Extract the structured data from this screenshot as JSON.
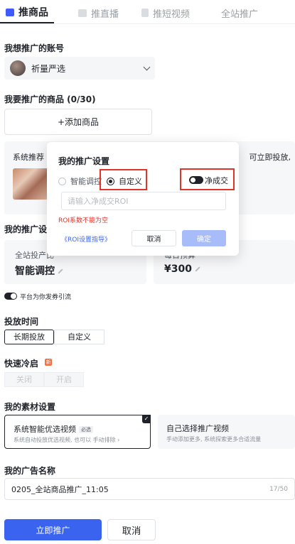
{
  "tabs": [
    {
      "label": "推商品",
      "icon": "shop-bag-icon",
      "active": true
    },
    {
      "label": "推直播",
      "icon": "live-camera-icon",
      "active": false
    },
    {
      "label": "推短视频",
      "icon": "video-file-icon",
      "active": false
    },
    {
      "label": "全站推广",
      "active": false
    }
  ],
  "account": {
    "label": "我想推广的账号",
    "name": "祈量严选",
    "icon": "chevron-down-icon"
  },
  "products": {
    "label": "我要推广的商品 (0/30)",
    "add_button": "+添加商品"
  },
  "recommend": {
    "title": "系统推荐",
    "right_text": "可立即投放,"
  },
  "promotion_settings": {
    "label": "我的推广设置",
    "metric_left": {
      "label": "全站投产比",
      "value": "智能调控"
    },
    "metric_right": {
      "label": "每日预算",
      "value": "¥300"
    }
  },
  "coupon_toggle": {
    "label": "平台为你发券引流",
    "on": true
  },
  "schedule": {
    "label": "投放时间",
    "options": [
      "长期投放",
      "自定义"
    ],
    "selected": "长期投放"
  },
  "quick_cold_start": {
    "label": "快速冷启",
    "badge": "新",
    "options": [
      "关闭",
      "开启"
    ]
  },
  "materials": {
    "label": "我的素材设置",
    "option_system": {
      "title": "系统智能优选视频",
      "tag": "必选",
      "desc": "系统自动投放优选视频, 也可以 手动排除 ›"
    },
    "option_self": {
      "title": "自己选择推广视频",
      "desc": "手动添加更多, 系统探索更多合适流量"
    }
  },
  "ad_name": {
    "label": "我的广告名称",
    "value": "0205_全站商品推广_11:05",
    "count": "17/50"
  },
  "actions": {
    "primary": "立即推广",
    "cancel": "取消"
  },
  "popover": {
    "title": "我的推广设置",
    "radio_smart": "智能调控",
    "radio_custom": "自定义",
    "selected": "自定义",
    "net_deal_label": "净成交",
    "net_deal_on": true,
    "roi_placeholder": "请输入净成交ROI",
    "roi_value": "",
    "roi_error": "ROI系数不能为空",
    "guide_link": "《ROI设置指导》",
    "cancel": "取消",
    "confirm": "确定"
  },
  "colors": {
    "primary": "#3a64ef",
    "error": "#e0332a",
    "highlight_box": "#e0332a"
  }
}
